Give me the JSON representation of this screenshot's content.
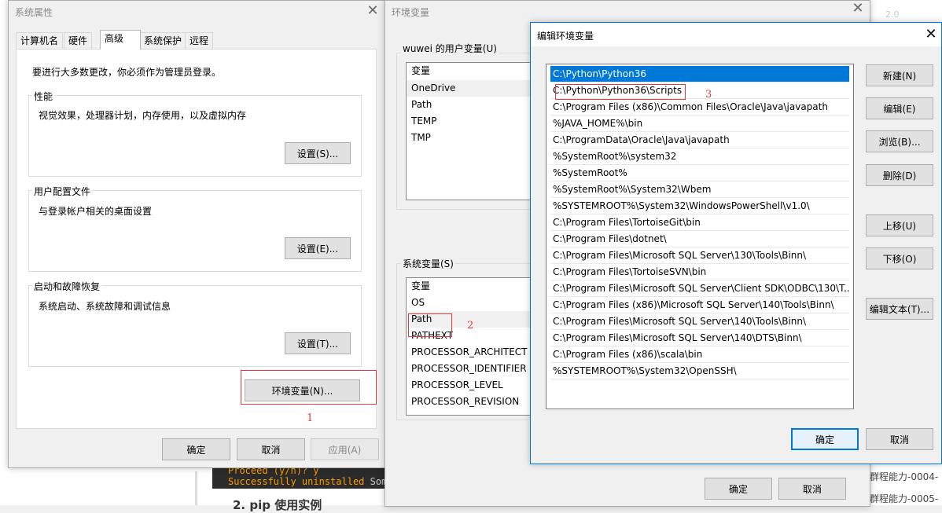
{
  "background_editor": {
    "terminal_line1": "Proceed (y/n)? y",
    "terminal_line2_a": "Successfully uninstalled",
    "terminal_line2_b": "Som",
    "heading": "2. pip 使用实例",
    "right_text_top": "2.0",
    "right_link1": "群程能力-0004-",
    "right_link2": "群程能力-0005-"
  },
  "system_props": {
    "title": "系统属性",
    "tabs": [
      "计算机名",
      "硬件",
      "高级",
      "系统保护",
      "远程"
    ],
    "active_tab": "高级",
    "admin_note": "要进行大多数更改，你必须作为管理员登录。",
    "performance": {
      "label": "性能",
      "desc": "视觉效果，处理器计划，内存使用，以及虚拟内存",
      "button": "设置(S)..."
    },
    "user_profile": {
      "label": "用户配置文件",
      "desc": "与登录帐户相关的桌面设置",
      "button": "设置(E)..."
    },
    "startup": {
      "label": "启动和故障恢复",
      "desc": "系统启动、系统故障和调试信息",
      "button": "设置(T)..."
    },
    "env_button": "环境变量(N)...",
    "ok": "确定",
    "cancel": "取消",
    "apply": "应用(A)",
    "annotation": "1"
  },
  "env_vars": {
    "title": "环境变量",
    "user_group": "wuwei 的用户变量(U)",
    "user_header": "变量",
    "user_vars": [
      "OneDrive",
      "Path",
      "TEMP",
      "TMP"
    ],
    "sys_group": "系统变量(S)",
    "sys_header": "变量",
    "sys_vars": [
      "OS",
      "Path",
      "PATHEXT",
      "PROCESSOR_ARCHITECT",
      "PROCESSOR_IDENTIFIER",
      "PROCESSOR_LEVEL",
      "PROCESSOR_REVISION"
    ],
    "ok": "确定",
    "cancel": "取消",
    "annotation": "2"
  },
  "edit_env": {
    "title": "编辑环境变量",
    "paths": [
      "C:\\Python\\Python36",
      "C:\\Python\\Python36\\Scripts",
      "C:\\Program Files (x86)\\Common Files\\Oracle\\Java\\javapath",
      "%JAVA_HOME%\\bin",
      "C:\\ProgramData\\Oracle\\Java\\javapath",
      "%SystemRoot%\\system32",
      "%SystemRoot%",
      "%SystemRoot%\\System32\\Wbem",
      "%SYSTEMROOT%\\System32\\WindowsPowerShell\\v1.0\\",
      "C:\\Program Files\\TortoiseGit\\bin",
      "C:\\Program Files\\dotnet\\",
      "C:\\Program Files\\Microsoft SQL Server\\130\\Tools\\Binn\\",
      "C:\\Program Files\\TortoiseSVN\\bin",
      "C:\\Program Files\\Microsoft SQL Server\\Client SDK\\ODBC\\130\\T...",
      "C:\\Program Files (x86)\\Microsoft SQL Server\\140\\Tools\\Binn\\",
      "C:\\Program Files\\Microsoft SQL Server\\140\\Tools\\Binn\\",
      "C:\\Program Files\\Microsoft SQL Server\\140\\DTS\\Binn\\",
      "C:\\Program Files (x86)\\scala\\bin",
      "%SYSTEMROOT%\\System32\\OpenSSH\\"
    ],
    "selected_index": 0,
    "buttons": {
      "new": "新建(N)",
      "edit": "编辑(E)",
      "browse": "浏览(B)...",
      "delete": "删除(D)",
      "up": "上移(U)",
      "down": "下移(O)",
      "edit_text": "编辑文本(T)..."
    },
    "ok": "确定",
    "cancel": "取消",
    "annotation": "3",
    "selection_color": "#0078d7"
  }
}
